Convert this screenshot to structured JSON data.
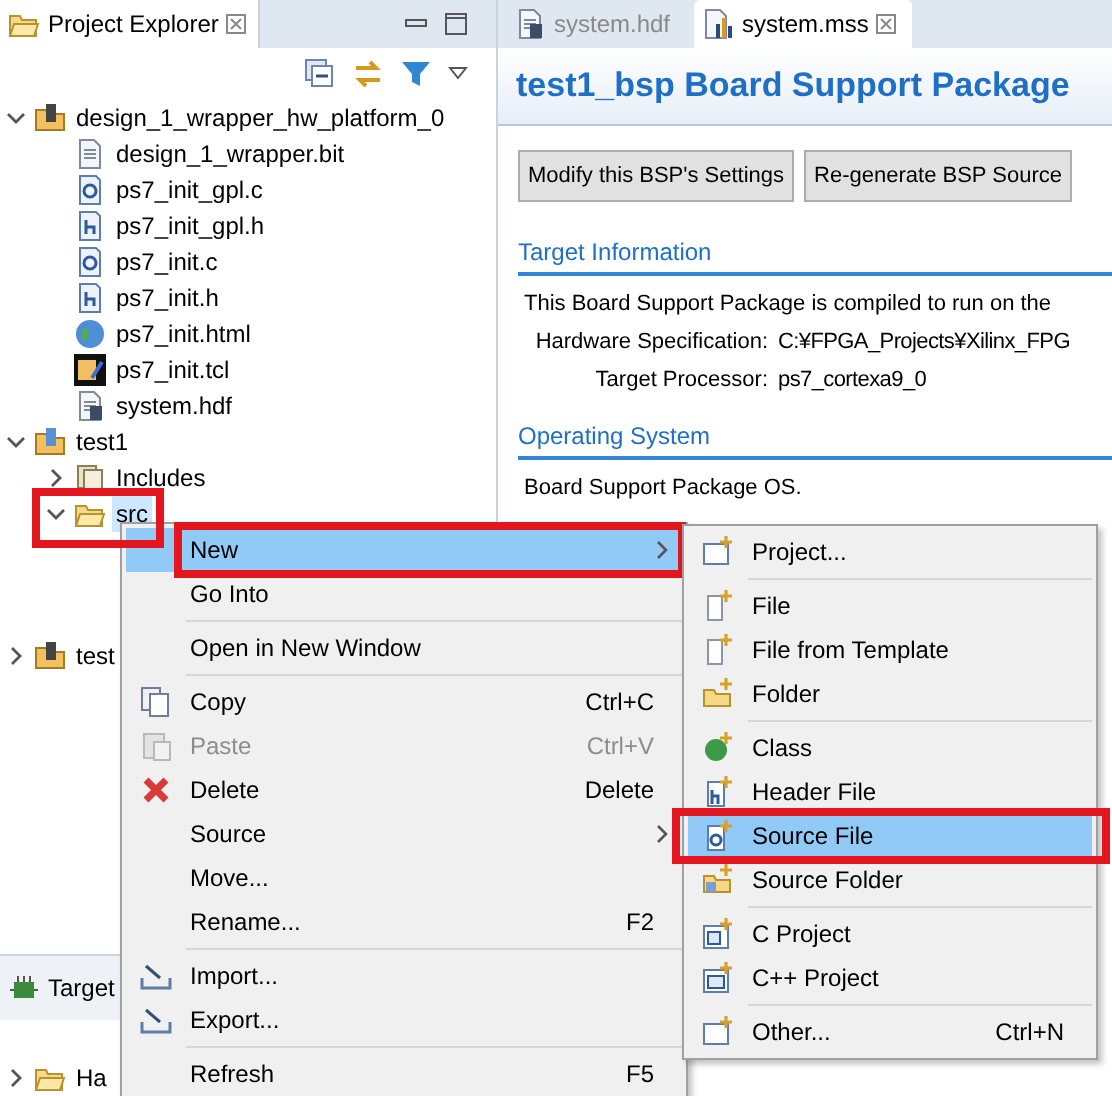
{
  "explorer": {
    "title": "Project Explorer",
    "tree": [
      {
        "label": "design_1_wrapper_hw_platform_0",
        "kind": "hw_project",
        "expanded": true,
        "selected": false,
        "children": [
          {
            "label": "design_1_wrapper.bit",
            "kind": "doc",
            "selected": false
          },
          {
            "label": "ps7_init_gpl.c",
            "kind": "c_file",
            "selected": false
          },
          {
            "label": "ps7_init_gpl.h",
            "kind": "h_file",
            "selected": false
          },
          {
            "label": "ps7_init.c",
            "kind": "c_file",
            "selected": false
          },
          {
            "label": "ps7_init.h",
            "kind": "h_file",
            "selected": false
          },
          {
            "label": "ps7_init.html",
            "kind": "web",
            "selected": false
          },
          {
            "label": "ps7_init.tcl",
            "kind": "script",
            "selected": false
          },
          {
            "label": "system.hdf",
            "kind": "hdf",
            "selected": false
          }
        ]
      },
      {
        "label": "test1",
        "kind": "c_project",
        "expanded": true,
        "selected": false,
        "children": [
          {
            "label": "Includes",
            "kind": "includes",
            "expanded": false,
            "selected": false
          },
          {
            "label": "src",
            "kind": "folder",
            "expanded": true,
            "selected": true,
            "annotated": true
          }
        ]
      },
      {
        "label": "test",
        "kind": "bsp_project",
        "expanded": false,
        "selected": false
      }
    ]
  },
  "target_panel": {
    "title": "Target",
    "tree": [
      {
        "label": "Ha",
        "kind": "folder",
        "expanded": false,
        "selected": false
      }
    ]
  },
  "editor": {
    "tabs": [
      {
        "label": "system.hdf",
        "kind": "hdf",
        "selected": false
      },
      {
        "label": "system.mss",
        "kind": "mss",
        "selected": true
      }
    ],
    "title": "test1_bsp Board Support Package",
    "buttons": [
      "Modify this BSP's Settings",
      "Re-generate BSP Source"
    ],
    "sections": [
      {
        "heading": "Target Information",
        "lines": [
          {
            "kind": "text",
            "text": "This Board Support Package is compiled to run on the"
          },
          {
            "kind": "field",
            "label": "Hardware Specification:",
            "value": "C:¥FPGA_Projects¥Xilinx_FPG"
          },
          {
            "kind": "field",
            "label": "Target Processor:",
            "value": "ps7_cortexa9_0"
          }
        ]
      },
      {
        "heading": "Operating System",
        "lines": [
          {
            "kind": "text",
            "text": "Board Support Package OS."
          }
        ]
      }
    ]
  },
  "context_menu": {
    "items": [
      {
        "kind": "plain",
        "label": "New",
        "submenu": true,
        "selected": true,
        "disabled": false,
        "annotated": true
      },
      {
        "kind": "plain",
        "label": "Go Into",
        "submenu": false,
        "selected": false,
        "disabled": false
      },
      {
        "kind": "separator"
      },
      {
        "kind": "plain",
        "label": "Open in New Window",
        "submenu": false,
        "selected": false,
        "disabled": false
      },
      {
        "kind": "separator"
      },
      {
        "kind": "copy",
        "label": "Copy",
        "shortcut": "Ctrl+C",
        "submenu": false,
        "selected": false,
        "disabled": false
      },
      {
        "kind": "paste",
        "label": "Paste",
        "shortcut": "Ctrl+V",
        "submenu": false,
        "selected": false,
        "disabled": true
      },
      {
        "kind": "delete",
        "label": "Delete",
        "shortcut": "Delete",
        "submenu": false,
        "selected": false,
        "disabled": false
      },
      {
        "kind": "plain",
        "label": "Source",
        "submenu": true,
        "selected": false,
        "disabled": false
      },
      {
        "kind": "plain",
        "label": "Move...",
        "submenu": false,
        "selected": false,
        "disabled": false
      },
      {
        "kind": "plain",
        "label": "Rename...",
        "shortcut": "F2",
        "submenu": false,
        "selected": false,
        "disabled": false
      },
      {
        "kind": "separator"
      },
      {
        "kind": "import",
        "label": "Import...",
        "submenu": false,
        "selected": false,
        "disabled": false
      },
      {
        "kind": "export",
        "label": "Export...",
        "submenu": false,
        "selected": false,
        "disabled": false
      },
      {
        "kind": "separator"
      },
      {
        "kind": "plain",
        "label": "Refresh",
        "shortcut": "F5",
        "submenu": false,
        "selected": false,
        "disabled": false
      }
    ]
  },
  "submenu": {
    "items": [
      {
        "kind": "project",
        "label": "Project...",
        "selected": false
      },
      {
        "kind": "separator"
      },
      {
        "kind": "file",
        "label": "File",
        "selected": false
      },
      {
        "kind": "file",
        "label": "File from Template",
        "selected": false
      },
      {
        "kind": "folder",
        "label": "Folder",
        "selected": false
      },
      {
        "kind": "separator"
      },
      {
        "kind": "class",
        "label": "Class",
        "selected": false
      },
      {
        "kind": "header",
        "label": "Header File",
        "selected": false
      },
      {
        "kind": "source",
        "label": "Source File",
        "selected": true,
        "annotated": true
      },
      {
        "kind": "sourcefolder",
        "label": "Source Folder",
        "selected": false
      },
      {
        "kind": "separator"
      },
      {
        "kind": "cproject",
        "label": "C Project",
        "selected": false
      },
      {
        "kind": "cppproject",
        "label": "C++ Project",
        "selected": false
      },
      {
        "kind": "separator"
      },
      {
        "kind": "project",
        "label": "Other...",
        "shortcut": "Ctrl+N",
        "selected": false
      }
    ]
  }
}
